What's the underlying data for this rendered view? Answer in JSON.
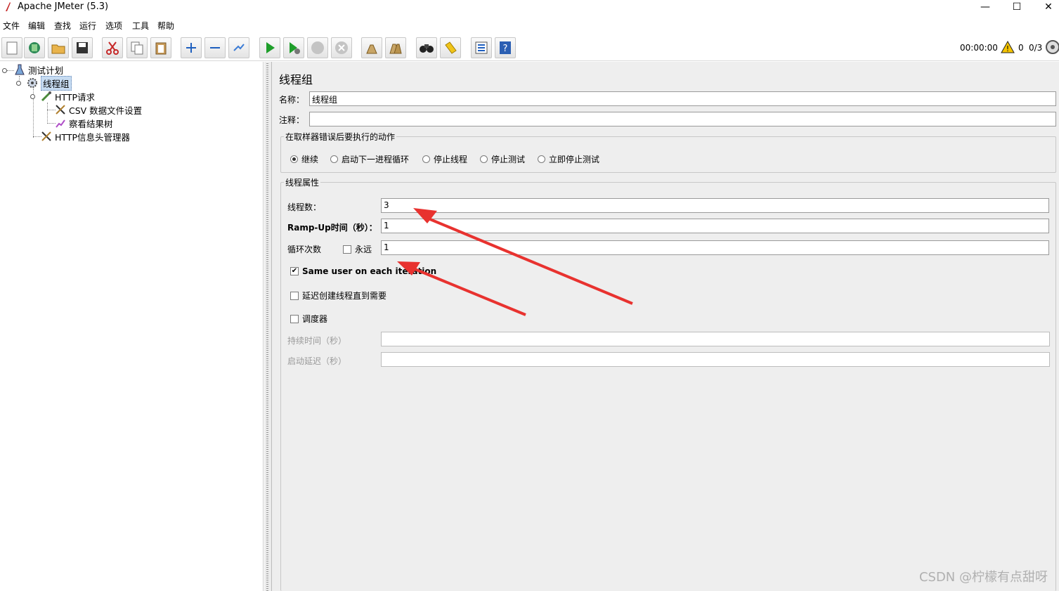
{
  "window": {
    "title": "Apache JMeter (5.3)",
    "min_glyph": "—",
    "max_glyph": "☐",
    "close_glyph": "✕"
  },
  "menu": [
    "文件",
    "编辑",
    "查找",
    "运行",
    "选项",
    "工具",
    "帮助"
  ],
  "toolbar": {
    "buttons": [
      "new-icon",
      "templates-icon",
      "open-icon",
      "save-icon",
      "cut-icon",
      "copy-icon",
      "paste-icon",
      "expand-icon",
      "collapse-icon",
      "toggle-icon",
      "start-icon",
      "start-no-pause-icon",
      "stop-icon",
      "shutdown-icon",
      "clear-icon",
      "clear-all-icon",
      "search-icon",
      "reset-search-icon",
      "function-helper-icon",
      "help-icon"
    ],
    "elapsed": "00:00:00",
    "warn_count": "0",
    "threads": "0/3"
  },
  "tree": {
    "nodes": [
      {
        "label": "测试计划",
        "icon": "test-plan-icon"
      },
      {
        "label": "线程组",
        "icon": "thread-group-icon"
      },
      {
        "label": "HTTP请求",
        "icon": "sampler-icon"
      },
      {
        "label": "CSV 数据文件设置",
        "icon": "config-icon"
      },
      {
        "label": "察看结果树",
        "icon": "listener-icon"
      },
      {
        "label": "HTTP信息头管理器",
        "icon": "config-icon"
      }
    ]
  },
  "panel": {
    "title": "线程组",
    "name_label": "名称：",
    "name_value": "线程组",
    "comment_label": "注释：",
    "comment_value": "",
    "error_group": {
      "legend": "在取样器错误后要执行的动作",
      "options": [
        "继续",
        "启动下一进程循环",
        "停止线程",
        "停止测试",
        "立即停止测试"
      ],
      "selected": "继续"
    },
    "thread_group": {
      "legend": "线程属性",
      "threads_label": "线程数：",
      "threads_value": "3",
      "rampup_label": "Ramp-Up时间（秒）：",
      "rampup_value": "1",
      "loop_label": "循环次数",
      "forever_label": "永远",
      "forever_checked": false,
      "loop_value": "1",
      "same_user_label": "Same user on each iteration",
      "same_user_checked": true,
      "delay_label": "延迟创建线程直到需要",
      "delay_checked": false,
      "scheduler_label": "调度器",
      "scheduler_checked": false,
      "duration_label": "持续时间（秒）",
      "duration_value": "",
      "startup_delay_label": "启动延迟（秒）",
      "startup_delay_value": ""
    }
  },
  "colors": {
    "arrow": "#e8322f",
    "selection": "#c7dcf2"
  },
  "watermark": "CSDN @柠檬有点甜呀"
}
